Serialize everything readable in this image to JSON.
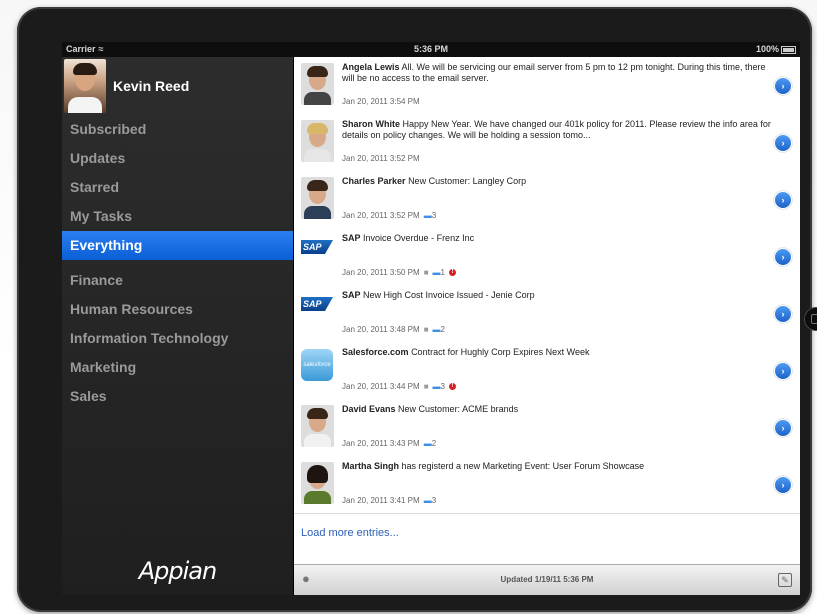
{
  "status_bar": {
    "carrier": "Carrier",
    "time": "5:36 PM",
    "battery": "100%"
  },
  "profile": {
    "name": "Kevin Reed"
  },
  "sidebar": {
    "primary": [
      {
        "label": "Subscribed",
        "active": false
      },
      {
        "label": "Updates",
        "active": false
      },
      {
        "label": "Starred",
        "active": false
      },
      {
        "label": "My Tasks",
        "active": false
      },
      {
        "label": "Everything",
        "active": true
      }
    ],
    "groups": [
      {
        "label": "Finance"
      },
      {
        "label": "Human Resources"
      },
      {
        "label": "Information Technology"
      },
      {
        "label": "Marketing"
      },
      {
        "label": "Sales"
      }
    ],
    "brand": "Appian"
  },
  "feed": [
    {
      "author": "Angela Lewis",
      "text": "All. We will be servicing our email server from 5 pm to 12 pm tonight. During this time, there will be no access to the email server.",
      "timestamp": "Jan 20, 2011 3:54 PM",
      "comments": "",
      "locked": false,
      "alert": false,
      "avatar": "person"
    },
    {
      "author": "Sharon White",
      "text": "Happy New Year. We have changed our 401k policy for 2011. Please review the info area for details on policy changes. We will be holding a session tomo...",
      "timestamp": "Jan 20, 2011 3:52 PM",
      "comments": "",
      "locked": false,
      "alert": false,
      "avatar": "person"
    },
    {
      "author": "Charles Parker",
      "text": "New Customer: Langley Corp",
      "timestamp": "Jan 20, 2011 3:52 PM",
      "comments": "3",
      "locked": false,
      "alert": false,
      "avatar": "person"
    },
    {
      "author": "SAP",
      "text": "Invoice Overdue - Frenz Inc",
      "timestamp": "Jan 20, 2011 3:50 PM",
      "comments": "1",
      "locked": true,
      "alert": true,
      "avatar": "sap"
    },
    {
      "author": "SAP",
      "text": "New High Cost Invoice Issued - Jenie Corp",
      "timestamp": "Jan 20, 2011 3:48 PM",
      "comments": "2",
      "locked": true,
      "alert": false,
      "avatar": "sap"
    },
    {
      "author": "Salesforce.com",
      "text": "Contract for Hughly Corp Expires Next Week",
      "timestamp": "Jan 20, 2011 3:44 PM",
      "comments": "3",
      "locked": true,
      "alert": true,
      "avatar": "salesforce"
    },
    {
      "author": "David Evans",
      "text": "New Customer: ACME brands",
      "timestamp": "Jan 20, 2011 3:43 PM",
      "comments": "2",
      "locked": false,
      "alert": false,
      "avatar": "person"
    },
    {
      "author": "Martha Singh",
      "text": "has registerd a new Marketing Event: User Forum Showcase",
      "timestamp": "Jan 20, 2011 3:41 PM",
      "comments": "3",
      "locked": false,
      "alert": false,
      "avatar": "person"
    }
  ],
  "load_more": "Load more entries...",
  "bottom_bar": {
    "updated": "Updated 1/19/11 5:36 PM"
  },
  "logos": {
    "sap": "SAP",
    "salesforce": "salesforce"
  }
}
